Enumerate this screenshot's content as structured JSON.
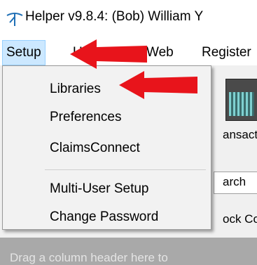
{
  "window": {
    "title": "Helper v9.8.4: (Bob) William Y"
  },
  "menubar": {
    "items": [
      {
        "label": "Setup"
      },
      {
        "label": "Ut"
      },
      {
        "label": "Web"
      },
      {
        "label": "Register"
      }
    ]
  },
  "setup_menu": {
    "items": [
      {
        "label": "Libraries"
      },
      {
        "label": "Preferences"
      },
      {
        "label": "ClaimsConnect"
      },
      {
        "label": "Multi-User Setup"
      },
      {
        "label": "Change Password"
      }
    ]
  },
  "toolbar": {
    "transactions_label": "ansact"
  },
  "filters": {
    "search_label": "arch",
    "lock_label": "ock Co"
  },
  "grid": {
    "group_hint": "Drag a column header here to"
  },
  "colors": {
    "annotation_arrow": "#e8141b",
    "menu_highlight": "#cce8ff"
  }
}
